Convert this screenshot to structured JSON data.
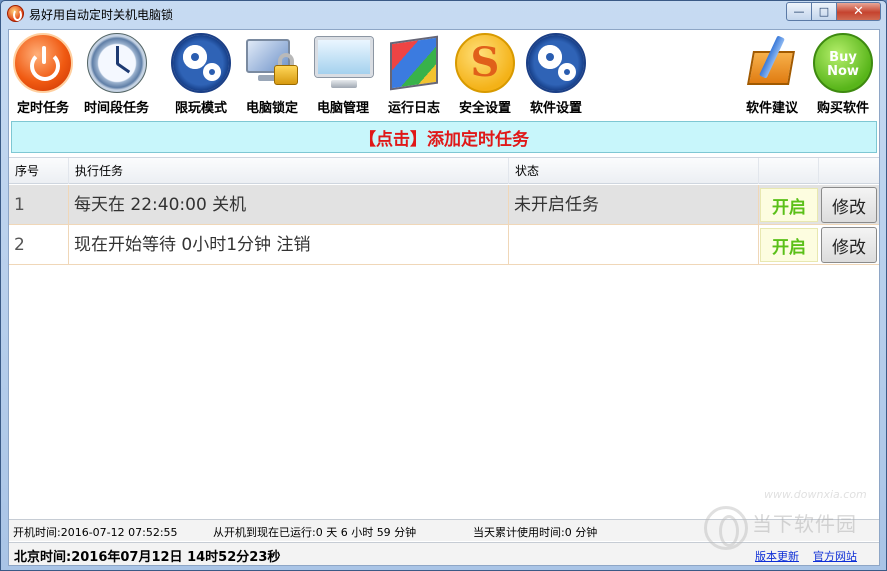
{
  "window": {
    "title": "易好用自动定时关机电脑锁",
    "min_glyph": "—",
    "max_glyph": "□",
    "close_glyph": "✕"
  },
  "toolbar": {
    "items": [
      {
        "label": "定时任务",
        "icon": "power-icon"
      },
      {
        "label": "时间段任务",
        "icon": "clock-icon"
      },
      {
        "label": "限玩模式",
        "icon": "gears-icon"
      },
      {
        "label": "电脑锁定",
        "icon": "computer-lock-icon"
      },
      {
        "label": "电脑管理",
        "icon": "monitor-icon"
      },
      {
        "label": "运行日志",
        "icon": "log-box-icon"
      },
      {
        "label": "安全设置",
        "icon": "s-shield-icon"
      },
      {
        "label": "软件设置",
        "icon": "gears-icon"
      },
      {
        "label": "软件建议",
        "icon": "pencil-notepad-icon"
      },
      {
        "label": "购买软件",
        "icon": "buy-now-icon"
      }
    ],
    "s_glyph": "S",
    "buy_line1": "Buy",
    "buy_line2": "Now"
  },
  "add_task": {
    "label": "【点击】添加定时任务"
  },
  "table": {
    "headers": [
      "序号",
      "执行任务",
      "状态"
    ],
    "rows": [
      {
        "num": "1",
        "task": "每天在 22:40:00 关机",
        "status": "未开启任务",
        "on_label": "开启",
        "edit_label": "修改"
      },
      {
        "num": "2",
        "task": "现在开始等待 0小时1分钟 注销",
        "status": "",
        "on_label": "开启",
        "edit_label": "修改"
      }
    ]
  },
  "status": {
    "boot_time": "开机时间:2016-07-12 07:52:55",
    "uptime": "从开机到现在已运行:0 天 6 小时 59 分钟",
    "today_usage": "当天累计使用时间:0 分钟",
    "beijing_time": "北京时间:2016年07月12日 14时52分23秒",
    "link_update": "版本更新",
    "link_site": "官方网站"
  },
  "watermark": {
    "text": "当下软件园",
    "url": "www.downxia.com"
  },
  "colors": {
    "accent_red": "#e01818",
    "on_green": "#5bc018",
    "banner_bg": "#c8f6fb",
    "link_blue": "#0d2ed6"
  }
}
